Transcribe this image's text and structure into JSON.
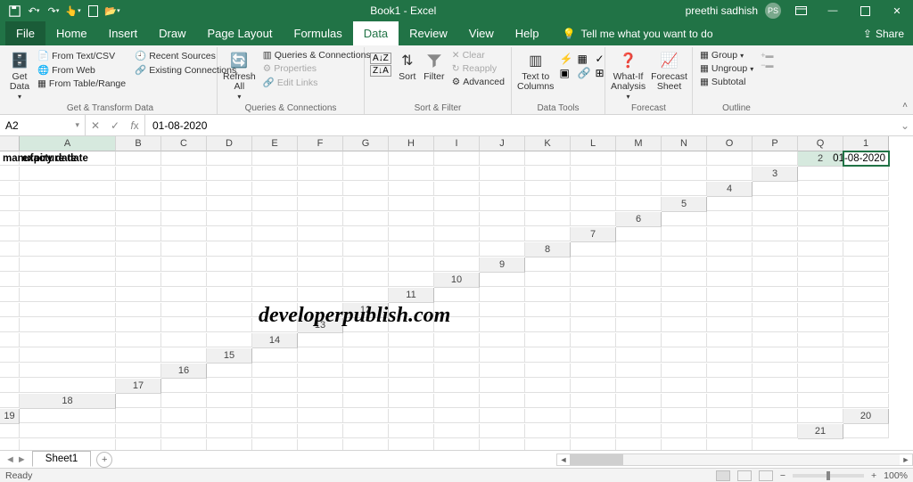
{
  "title": "Book1 - Excel",
  "user": {
    "name": "preethi sadhish",
    "initials": "PS"
  },
  "share_label": "Share",
  "tabs": [
    "File",
    "Home",
    "Insert",
    "Draw",
    "Page Layout",
    "Formulas",
    "Data",
    "Review",
    "View",
    "Help"
  ],
  "active_tab": "Data",
  "tellme": "Tell me what you want to do",
  "ribbon": {
    "getdata": {
      "get_data": "Get\nData",
      "text_csv": "From Text/CSV",
      "web": "From Web",
      "table": "From Table/Range",
      "recent": "Recent Sources",
      "existing": "Existing Connections",
      "group": "Get & Transform Data"
    },
    "queries": {
      "refresh": "Refresh\nAll",
      "qc": "Queries & Connections",
      "props": "Properties",
      "edit": "Edit Links",
      "group": "Queries & Connections"
    },
    "sortfilter": {
      "sort": "Sort",
      "filter": "Filter",
      "clear": "Clear",
      "reapply": "Reapply",
      "advanced": "Advanced",
      "group": "Sort & Filter"
    },
    "datatools": {
      "t2c": "Text to\nColumns",
      "group": "Data Tools"
    },
    "forecast": {
      "whatif": "What-If\nAnalysis",
      "sheet": "Forecast\nSheet",
      "group": "Forecast"
    },
    "outline": {
      "grp": "Group",
      "ungrp": "Ungroup",
      "sub": "Subtotal",
      "group": "Outline"
    }
  },
  "namebox": "A2",
  "formula": "01-08-2020",
  "columns": [
    "A",
    "B",
    "C",
    "D",
    "E",
    "F",
    "G",
    "H",
    "I",
    "J",
    "K",
    "L",
    "M",
    "N",
    "O",
    "P",
    "Q"
  ],
  "rows": [
    1,
    2,
    3,
    4,
    5,
    6,
    7,
    8,
    9,
    10,
    11,
    12,
    13,
    14,
    15,
    16,
    17,
    18,
    19,
    20,
    21
  ],
  "cells": {
    "A1": "manufacture date",
    "B1": "expiry date",
    "A2": "01-08-2020"
  },
  "watermark": "developerpublish.com",
  "sheet": "Sheet1",
  "status": "Ready",
  "zoom": "100%"
}
